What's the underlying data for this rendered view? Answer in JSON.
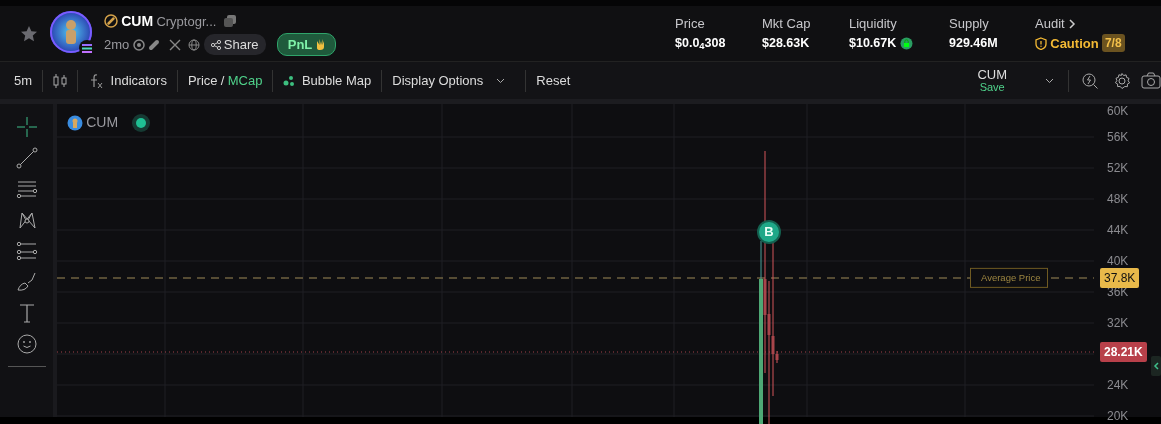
{
  "header": {
    "symbol": "CUM",
    "name": "Cryptogr...",
    "age": "2mo",
    "share": "Share",
    "pnl": "PnL"
  },
  "stats": [
    {
      "label": "Price",
      "value": "$0.0$_{4}$308",
      "kind": "plain"
    },
    {
      "label": "Mkt Cap",
      "value": "$28.63K",
      "kind": "plain"
    },
    {
      "label": "Liquidity",
      "value": "$10.67K",
      "kind": "locked"
    },
    {
      "label": "Supply",
      "value": "929.46M",
      "kind": "plain"
    }
  ],
  "audit": {
    "label": "Audit",
    "status": "Caution",
    "score": "7/8"
  },
  "toolbar": {
    "interval": "5m",
    "indicators": "Indicators",
    "price": "Price",
    "separator": "/",
    "mcap": "MCap",
    "mcap_selected": true,
    "bubble": "Bubble Map",
    "display": "Display Options",
    "reset": "Reset",
    "layout_name": "CUM",
    "layout_save": "Save"
  },
  "chart": {
    "legend": "CUM",
    "y_ticks_upper": [
      "60K",
      "56K",
      "52K",
      "48K",
      "44K",
      "40K",
      "36K",
      "32K"
    ],
    "y_ticks_lower": [
      "24K",
      "20K"
    ],
    "avg_label": "Average Price",
    "avg_tag": "37.8K",
    "last_tag": "28.21K",
    "marker": "B"
  }
}
